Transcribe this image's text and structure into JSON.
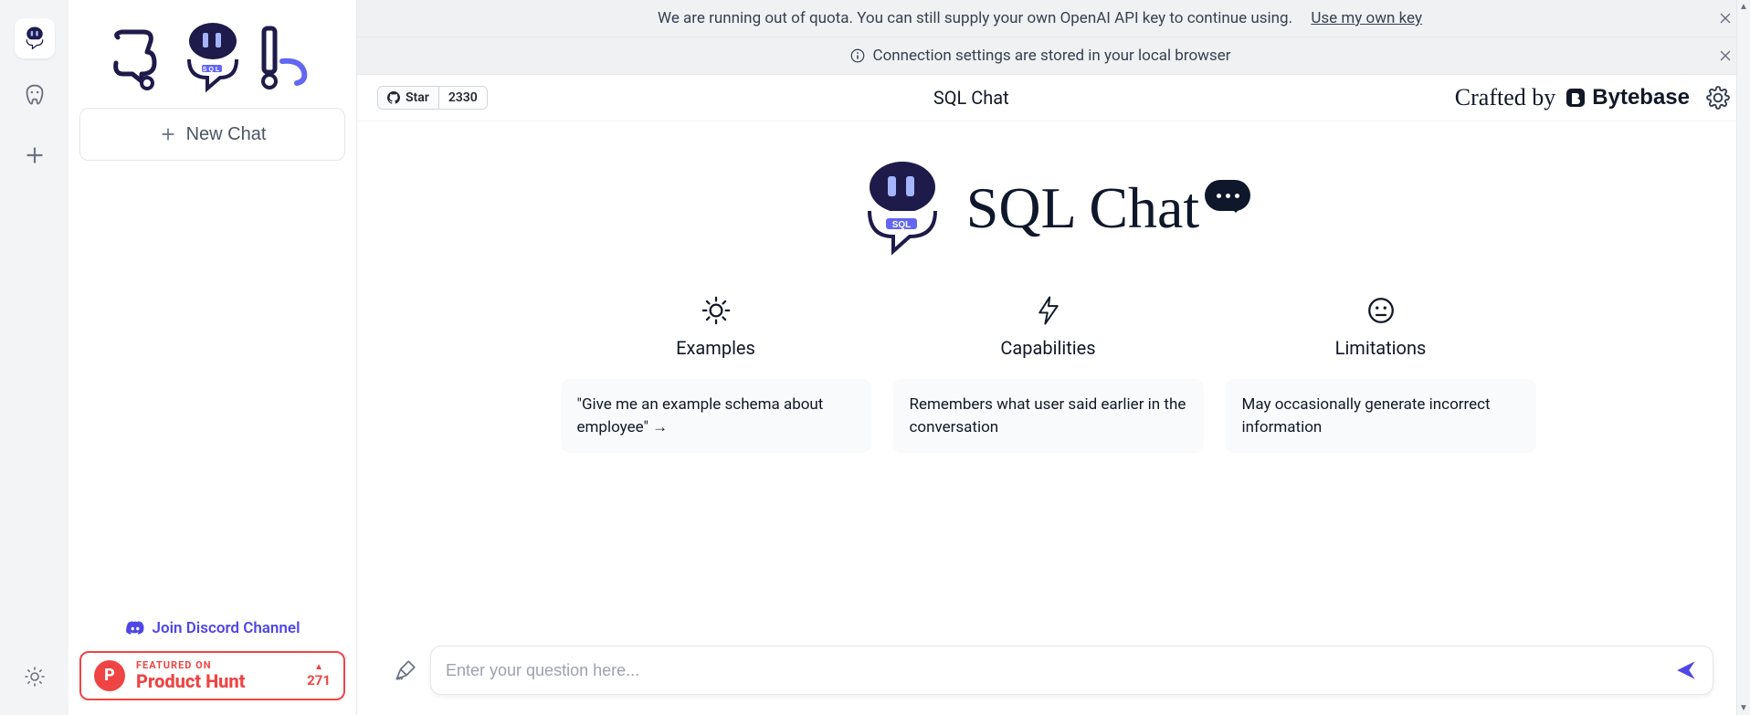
{
  "banners": {
    "quota": {
      "text": "We are running out of quota. You can still supply your own OpenAI API key to continue using.",
      "link": "Use my own key"
    },
    "storage": {
      "text": "Connection settings are stored in your local browser"
    }
  },
  "sidebar": {
    "logo_text": "SQL",
    "new_chat": "New Chat",
    "discord_label": "Join Discord Channel",
    "product_hunt": {
      "featured": "FEATURED ON",
      "name": "Product Hunt",
      "P": "P",
      "votes": "271",
      "triangle": "▲"
    }
  },
  "topbar": {
    "star_label": "Star",
    "star_count": "2330",
    "title": "SQL Chat",
    "crafted_by": "Crafted by",
    "brand": "Bytebase"
  },
  "hero": {
    "title": "SQL Chat"
  },
  "columns": [
    {
      "title": "Examples",
      "card": "\"Give me an example schema about employee\" →",
      "interactable": true
    },
    {
      "title": "Capabilities",
      "card": "Remembers what user said earlier in the conversation",
      "interactable": false
    },
    {
      "title": "Limitations",
      "card": "May occasionally generate incorrect information",
      "interactable": false
    }
  ],
  "composer": {
    "placeholder": "Enter your question here..."
  }
}
